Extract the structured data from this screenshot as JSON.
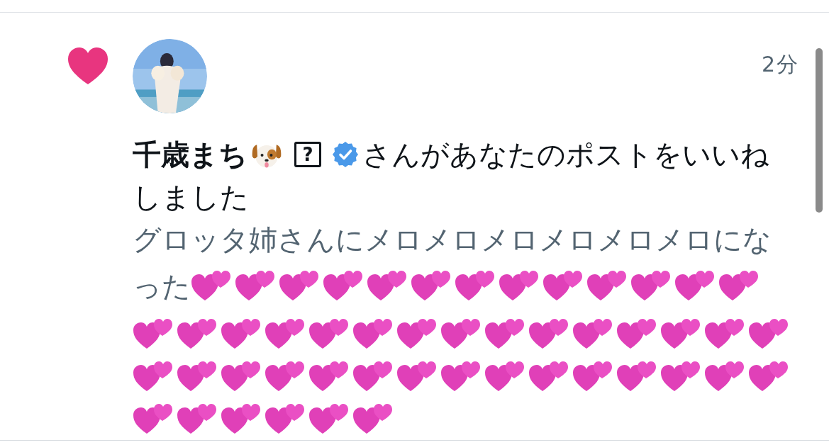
{
  "notification": {
    "time": "2分",
    "user": {
      "name": "千歳まち",
      "unknown_glyph": "?",
      "verified": true
    },
    "action_text_lines": [
      "さんがあなたのポストをいいね",
      "しました"
    ],
    "post": {
      "text_lines": [
        "グロッタ姉さんにメロメロメロメロメロメロにな",
        "った"
      ]
    }
  }
}
